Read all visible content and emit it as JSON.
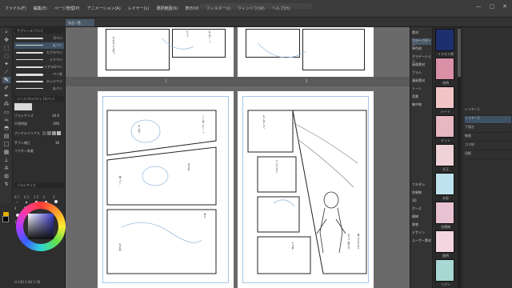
{
  "menu": {
    "items": [
      "ファイル(F)",
      "編集(E)",
      "ページ管理(P)",
      "アニメーション(A)",
      "レイヤー(L)",
      "選択範囲(S)",
      "表示(V)",
      "フィルター(I)",
      "ウィンドウ(W)",
      "ヘルプ(H)"
    ]
  },
  "window_controls": [
    "—",
    "▢",
    "✕"
  ],
  "toolbar": {
    "active_tab": "作品一覧"
  },
  "tool_panel": {
    "header": "サブツール [ペン]",
    "brushes": [
      {
        "label": "Gペン"
      },
      {
        "label": "丸ペン"
      },
      {
        "label": "カブラペン"
      },
      {
        "label": "ミリペン"
      },
      {
        "label": "リアルGペン"
      },
      {
        "label": "ペン先"
      },
      {
        "label": "エッジペン"
      },
      {
        "label": "丸ペン"
      }
    ]
  },
  "tool_property": {
    "header": "ツールプロパティ [Gペン]",
    "rows": [
      {
        "label": "ブラシサイズ",
        "value": "10.0"
      },
      {
        "label": "不透明度",
        "value": "100"
      },
      {
        "label": "アンチエイリアス",
        "value": ""
      },
      {
        "label": "手ブレ補正",
        "value": "10"
      },
      {
        "label": "ベクター吸着",
        "value": ""
      }
    ]
  },
  "brush_sizes": {
    "header": "ブラシサイズ",
    "labels": [
      "0.7",
      "0.1",
      "1.5",
      "2",
      "3",
      "4",
      "5",
      "6",
      "8",
      "10",
      "12",
      "15",
      "17",
      "20",
      "25",
      "30"
    ]
  },
  "color": {
    "accent_fg": "#000000",
    "accent_bg": "#ffffff",
    "values": "H 240  S 66  V 28"
  },
  "canvas": {
    "page_numbers": [
      "1",
      "2"
    ]
  },
  "manga": {
    "dialogue": [
      "えっ？",
      "なんで…？",
      "だれかいるの？",
      "そんな…",
      "ここは どこ…？",
      "まさか",
      "待って…",
      "ほら",
      "大丈夫",
      "もしかして",
      "ついてきて",
      "じゃあ…",
      "もう一度だけ",
      "信じられない"
    ]
  },
  "materials": {
    "items": [
      "素材",
      "カラーパターン",
      "単色柄",
      "グラデーション",
      "画像素材",
      "ブラシ",
      "漫画素材",
      "トーン",
      "背景",
      "集中線",
      "フキダシ",
      "効果線",
      "3D",
      "ポーズ",
      "模様",
      "質感",
      "デザイン",
      "ユーザー素材"
    ]
  },
  "thumbnails": [
    {
      "label": "イラスト柄",
      "color": "#1d2f6e"
    },
    {
      "label": "花柄",
      "color": "#d98fa6"
    },
    {
      "label": "ハート",
      "color": "#f1c5c5"
    },
    {
      "label": "ドット",
      "color": "#e7b7c2"
    },
    {
      "label": "水玉",
      "color": "#efd1d8"
    },
    {
      "label": "水彩",
      "color": "#bfe3ee"
    },
    {
      "label": "花模様",
      "color": "#e9c2d2"
    },
    {
      "label": "星柄",
      "color": "#f4d6e0"
    },
    {
      "label": "リボン",
      "color": "#a7d8d4"
    }
  ],
  "layers": {
    "rows": [
      "レイヤー1",
      "レイヤー2",
      "下描き",
      "線画",
      "コマ枠",
      "用紙"
    ]
  }
}
